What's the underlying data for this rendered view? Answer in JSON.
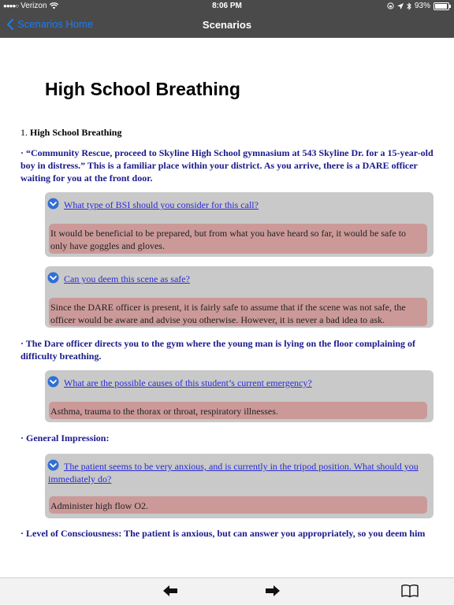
{
  "status_bar": {
    "carrier": "Verizon",
    "time": "8:06 PM",
    "battery": "93%",
    "battery_level": 0.93
  },
  "nav": {
    "back_label": "Scenarios Home",
    "title": "Scenarios"
  },
  "page": {
    "title": "High School Breathing",
    "section_number": "1.",
    "section_title": "High School Breathing"
  },
  "bullets": [
    "· “Community Rescue, proceed to Skyline High School gymnasium at 543 Skyline Dr. for a 15-year-old boy in distress.” This is a familiar place within your district. As you arrive, there is a DARE officer waiting for you at the front door.",
    "· The Dare officer directs you to the gym where the young man is lying on the floor complaining of difficulty breathing.",
    "· General Impression:",
    "· Level of Consciousness: The patient is anxious, but can answer you appropriately, so you deem him"
  ],
  "qa": [
    {
      "question": "What type of BSI should you consider for this call?",
      "answer": "It would be beneficial to be prepared, but from what you have heard so far, it would be safe to only have goggles and gloves."
    },
    {
      "question": "Can you deem this scene as safe?",
      "answer": "Since the DARE officer is present, it is fairly safe to assume that if the scene was not safe, the officer would be aware and advise you otherwise. However, it is never a bad idea to ask."
    },
    {
      "question": "What are the possible causes of this student’s current emergency?",
      "answer": "Asthma, trauma to the thorax or throat, respiratory illnesses."
    },
    {
      "question": "The patient seems to be very anxious, and is currently in the tripod position. What should you immediately do?",
      "answer": "Administer high flow O2."
    }
  ],
  "icons": {
    "back": "chevron-left-icon",
    "expand": "chevron-down-circle-icon",
    "prev": "arrow-left-icon",
    "next": "arrow-right-icon",
    "book": "book-icon"
  },
  "colors": {
    "bar": "#4a4a4a",
    "ios_blue": "#1a7cf5",
    "bullet_text": "#1a1a8c",
    "link": "#2a2ad6",
    "qa_box": "#c9c9c9",
    "answer_bg": "#cc9999"
  }
}
